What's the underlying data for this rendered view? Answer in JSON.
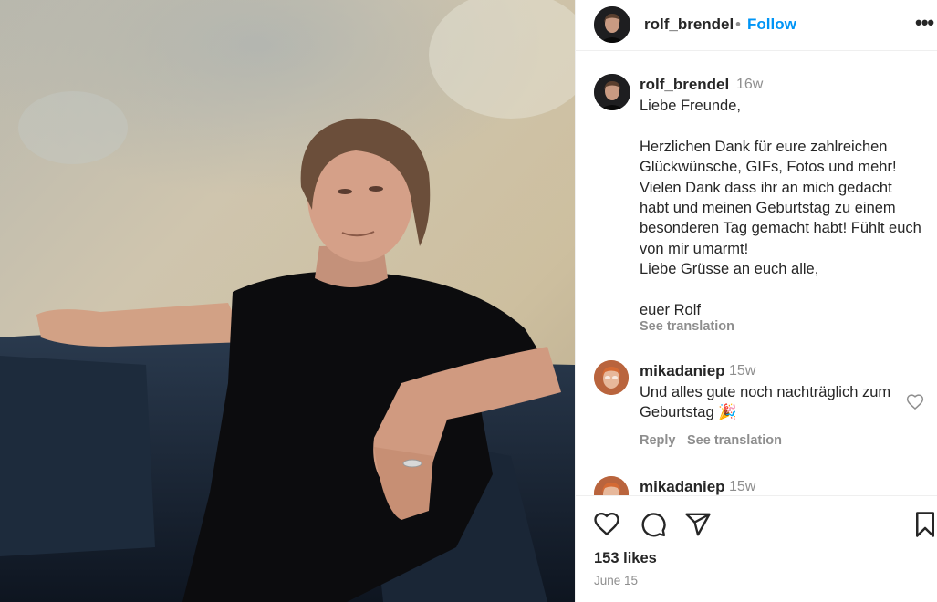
{
  "post": {
    "username": "rolf_brendel",
    "follow_label": "Follow",
    "separator": "•",
    "more_label": "•••"
  },
  "caption": {
    "username": "rolf_brendel",
    "time": "16w",
    "text": "Liebe Freunde,\n\nHerzlichen Dank für eure zahlreichen Glückwünsche, GIFs, Fotos und mehr! Vielen Dank dass ihr an mich gedacht habt und meinen Geburtstag zu einem besonderen Tag gemacht habt! Fühlt euch von mir umarmt!\nLiebe Grüsse an euch alle,\n\neuer Rolf",
    "see_translation": "See translation"
  },
  "comments": [
    {
      "username": "mikadaniep",
      "time": "15w",
      "text": "Und alles gute noch nachträglich zum Geburtstag 🎉",
      "reply_label": "Reply",
      "see_translation": "See translation"
    },
    {
      "username": "mikadaniep",
      "time": "15w"
    }
  ],
  "footer": {
    "likes": "153 likes",
    "date": "June 15"
  },
  "icons": {
    "like": "heart-icon",
    "comment": "comment-icon",
    "share": "share-icon",
    "save": "bookmark-icon"
  },
  "colors": {
    "accent": "#0095f6",
    "secondary_text": "#8e8e8e",
    "primary_text": "#262626"
  }
}
